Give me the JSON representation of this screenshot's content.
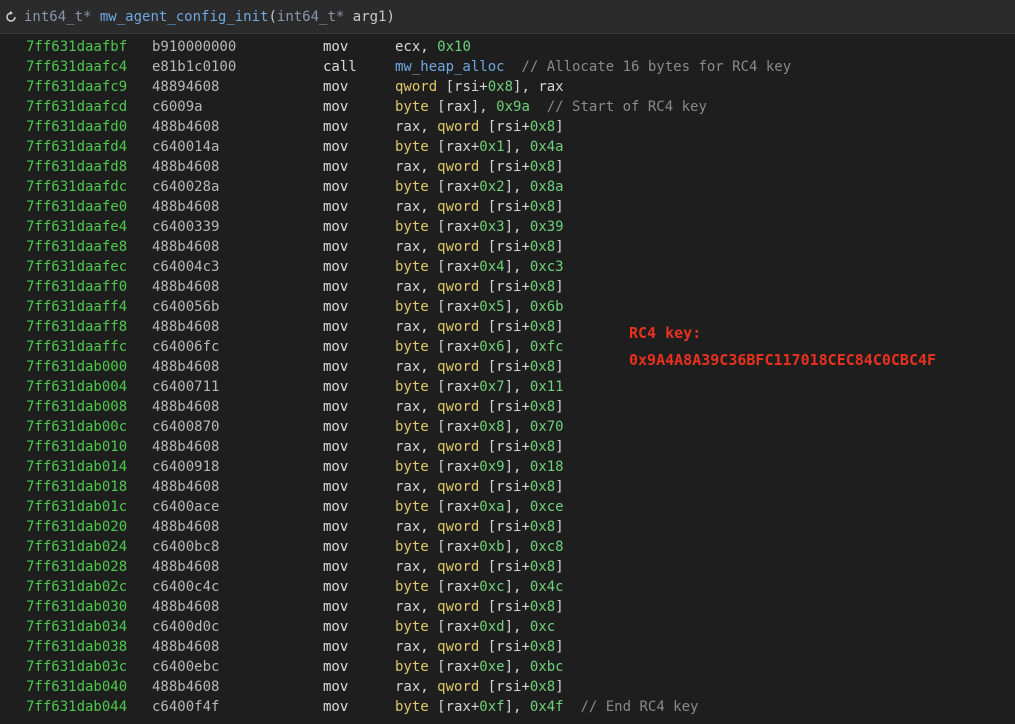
{
  "header": {
    "refresh_icon": "refresh-icon",
    "sig_ret": "int64_t*",
    "sig_name": "mw_agent_config_init",
    "sig_open": "(",
    "sig_argtype": "int64_t*",
    "sig_arg": "arg1)"
  },
  "annotation": {
    "label": "RC4 key:",
    "value": "0x9A4A8A39C36BFC117018CEC84C0CBC4F",
    "color": "#e8321e"
  },
  "colors": {
    "background": "#1e1e1e",
    "address": "#4ec94e",
    "number": "#6fd07a",
    "keyword": "#e0c86a",
    "function": "#6fa8e0",
    "comment": "#8a8a8a"
  },
  "rows": [
    {
      "addr": "7ff631daafbf",
      "bytes": "b910000000",
      "mnem": "mov",
      "ops": [
        [
          "reg",
          "ecx, "
        ],
        [
          "num",
          "0x10"
        ]
      ]
    },
    {
      "addr": "7ff631daafc4",
      "bytes": "e81b1c0100",
      "mnem": "call",
      "ops": [
        [
          "fn",
          "mw_heap_alloc"
        ],
        [
          "cmt",
          "  // Allocate 16 bytes for RC4 key"
        ]
      ]
    },
    {
      "addr": "7ff631daafc9",
      "bytes": "48894608",
      "mnem": "mov",
      "ops": [
        [
          "kw",
          "qword"
        ],
        [
          "p",
          " [rsi+"
        ],
        [
          "num",
          "0x8"
        ],
        [
          "p",
          "], rax"
        ]
      ]
    },
    {
      "addr": "7ff631daafcd",
      "bytes": "c6009a",
      "mnem": "mov",
      "ops": [
        [
          "kw",
          "byte"
        ],
        [
          "p",
          " [rax], "
        ],
        [
          "num",
          "0x9a"
        ],
        [
          "cmt",
          "  // Start of RC4 key"
        ]
      ]
    },
    {
      "addr": "7ff631daafd0",
      "bytes": "488b4608",
      "mnem": "mov",
      "ops": [
        [
          "p",
          "rax, "
        ],
        [
          "kw",
          "qword"
        ],
        [
          "p",
          " [rsi+"
        ],
        [
          "num",
          "0x8"
        ],
        [
          "p",
          "]"
        ]
      ]
    },
    {
      "addr": "7ff631daafd4",
      "bytes": "c640014a",
      "mnem": "mov",
      "ops": [
        [
          "kw",
          "byte"
        ],
        [
          "p",
          " [rax+"
        ],
        [
          "num",
          "0x1"
        ],
        [
          "p",
          "], "
        ],
        [
          "num",
          "0x4a"
        ]
      ]
    },
    {
      "addr": "7ff631daafd8",
      "bytes": "488b4608",
      "mnem": "mov",
      "ops": [
        [
          "p",
          "rax, "
        ],
        [
          "kw",
          "qword"
        ],
        [
          "p",
          " [rsi+"
        ],
        [
          "num",
          "0x8"
        ],
        [
          "p",
          "]"
        ]
      ]
    },
    {
      "addr": "7ff631daafdc",
      "bytes": "c640028a",
      "mnem": "mov",
      "ops": [
        [
          "kw",
          "byte"
        ],
        [
          "p",
          " [rax+"
        ],
        [
          "num",
          "0x2"
        ],
        [
          "p",
          "], "
        ],
        [
          "num",
          "0x8a"
        ]
      ]
    },
    {
      "addr": "7ff631daafe0",
      "bytes": "488b4608",
      "mnem": "mov",
      "ops": [
        [
          "p",
          "rax, "
        ],
        [
          "kw",
          "qword"
        ],
        [
          "p",
          " [rsi+"
        ],
        [
          "num",
          "0x8"
        ],
        [
          "p",
          "]"
        ]
      ]
    },
    {
      "addr": "7ff631daafe4",
      "bytes": "c6400339",
      "mnem": "mov",
      "ops": [
        [
          "kw",
          "byte"
        ],
        [
          "p",
          " [rax+"
        ],
        [
          "num",
          "0x3"
        ],
        [
          "p",
          "], "
        ],
        [
          "num",
          "0x39"
        ]
      ]
    },
    {
      "addr": "7ff631daafe8",
      "bytes": "488b4608",
      "mnem": "mov",
      "ops": [
        [
          "p",
          "rax, "
        ],
        [
          "kw",
          "qword"
        ],
        [
          "p",
          " [rsi+"
        ],
        [
          "num",
          "0x8"
        ],
        [
          "p",
          "]"
        ]
      ]
    },
    {
      "addr": "7ff631daafec",
      "bytes": "c64004c3",
      "mnem": "mov",
      "ops": [
        [
          "kw",
          "byte"
        ],
        [
          "p",
          " [rax+"
        ],
        [
          "num",
          "0x4"
        ],
        [
          "p",
          "], "
        ],
        [
          "num",
          "0xc3"
        ]
      ]
    },
    {
      "addr": "7ff631daaff0",
      "bytes": "488b4608",
      "mnem": "mov",
      "ops": [
        [
          "p",
          "rax, "
        ],
        [
          "kw",
          "qword"
        ],
        [
          "p",
          " [rsi+"
        ],
        [
          "num",
          "0x8"
        ],
        [
          "p",
          "]"
        ]
      ]
    },
    {
      "addr": "7ff631daaff4",
      "bytes": "c640056b",
      "mnem": "mov",
      "ops": [
        [
          "kw",
          "byte"
        ],
        [
          "p",
          " [rax+"
        ],
        [
          "num",
          "0x5"
        ],
        [
          "p",
          "], "
        ],
        [
          "num",
          "0x6b"
        ]
      ]
    },
    {
      "addr": "7ff631daaff8",
      "bytes": "488b4608",
      "mnem": "mov",
      "ops": [
        [
          "p",
          "rax, "
        ],
        [
          "kw",
          "qword"
        ],
        [
          "p",
          " [rsi+"
        ],
        [
          "num",
          "0x8"
        ],
        [
          "p",
          "]"
        ]
      ]
    },
    {
      "addr": "7ff631daaffc",
      "bytes": "c64006fc",
      "mnem": "mov",
      "ops": [
        [
          "kw",
          "byte"
        ],
        [
          "p",
          " [rax+"
        ],
        [
          "num",
          "0x6"
        ],
        [
          "p",
          "], "
        ],
        [
          "num",
          "0xfc"
        ]
      ]
    },
    {
      "addr": "7ff631dab000",
      "bytes": "488b4608",
      "mnem": "mov",
      "ops": [
        [
          "p",
          "rax, "
        ],
        [
          "kw",
          "qword"
        ],
        [
          "p",
          " [rsi+"
        ],
        [
          "num",
          "0x8"
        ],
        [
          "p",
          "]"
        ]
      ]
    },
    {
      "addr": "7ff631dab004",
      "bytes": "c6400711",
      "mnem": "mov",
      "ops": [
        [
          "kw",
          "byte"
        ],
        [
          "p",
          " [rax+"
        ],
        [
          "num",
          "0x7"
        ],
        [
          "p",
          "], "
        ],
        [
          "num",
          "0x11"
        ]
      ]
    },
    {
      "addr": "7ff631dab008",
      "bytes": "488b4608",
      "mnem": "mov",
      "ops": [
        [
          "p",
          "rax, "
        ],
        [
          "kw",
          "qword"
        ],
        [
          "p",
          " [rsi+"
        ],
        [
          "num",
          "0x8"
        ],
        [
          "p",
          "]"
        ]
      ]
    },
    {
      "addr": "7ff631dab00c",
      "bytes": "c6400870",
      "mnem": "mov",
      "ops": [
        [
          "kw",
          "byte"
        ],
        [
          "p",
          " [rax+"
        ],
        [
          "num",
          "0x8"
        ],
        [
          "p",
          "], "
        ],
        [
          "num",
          "0x70"
        ]
      ]
    },
    {
      "addr": "7ff631dab010",
      "bytes": "488b4608",
      "mnem": "mov",
      "ops": [
        [
          "p",
          "rax, "
        ],
        [
          "kw",
          "qword"
        ],
        [
          "p",
          " [rsi+"
        ],
        [
          "num",
          "0x8"
        ],
        [
          "p",
          "]"
        ]
      ]
    },
    {
      "addr": "7ff631dab014",
      "bytes": "c6400918",
      "mnem": "mov",
      "ops": [
        [
          "kw",
          "byte"
        ],
        [
          "p",
          " [rax+"
        ],
        [
          "num",
          "0x9"
        ],
        [
          "p",
          "], "
        ],
        [
          "num",
          "0x18"
        ]
      ]
    },
    {
      "addr": "7ff631dab018",
      "bytes": "488b4608",
      "mnem": "mov",
      "ops": [
        [
          "p",
          "rax, "
        ],
        [
          "kw",
          "qword"
        ],
        [
          "p",
          " [rsi+"
        ],
        [
          "num",
          "0x8"
        ],
        [
          "p",
          "]"
        ]
      ]
    },
    {
      "addr": "7ff631dab01c",
      "bytes": "c6400ace",
      "mnem": "mov",
      "ops": [
        [
          "kw",
          "byte"
        ],
        [
          "p",
          " [rax+"
        ],
        [
          "num",
          "0xa"
        ],
        [
          "p",
          "], "
        ],
        [
          "num",
          "0xce"
        ]
      ]
    },
    {
      "addr": "7ff631dab020",
      "bytes": "488b4608",
      "mnem": "mov",
      "ops": [
        [
          "p",
          "rax, "
        ],
        [
          "kw",
          "qword"
        ],
        [
          "p",
          " [rsi+"
        ],
        [
          "num",
          "0x8"
        ],
        [
          "p",
          "]"
        ]
      ]
    },
    {
      "addr": "7ff631dab024",
      "bytes": "c6400bc8",
      "mnem": "mov",
      "ops": [
        [
          "kw",
          "byte"
        ],
        [
          "p",
          " [rax+"
        ],
        [
          "num",
          "0xb"
        ],
        [
          "p",
          "], "
        ],
        [
          "num",
          "0xc8"
        ]
      ]
    },
    {
      "addr": "7ff631dab028",
      "bytes": "488b4608",
      "mnem": "mov",
      "ops": [
        [
          "p",
          "rax, "
        ],
        [
          "kw",
          "qword"
        ],
        [
          "p",
          " [rsi+"
        ],
        [
          "num",
          "0x8"
        ],
        [
          "p",
          "]"
        ]
      ]
    },
    {
      "addr": "7ff631dab02c",
      "bytes": "c6400c4c",
      "mnem": "mov",
      "ops": [
        [
          "kw",
          "byte"
        ],
        [
          "p",
          " [rax+"
        ],
        [
          "num",
          "0xc"
        ],
        [
          "p",
          "], "
        ],
        [
          "num",
          "0x4c"
        ]
      ]
    },
    {
      "addr": "7ff631dab030",
      "bytes": "488b4608",
      "mnem": "mov",
      "ops": [
        [
          "p",
          "rax, "
        ],
        [
          "kw",
          "qword"
        ],
        [
          "p",
          " [rsi+"
        ],
        [
          "num",
          "0x8"
        ],
        [
          "p",
          "]"
        ]
      ]
    },
    {
      "addr": "7ff631dab034",
      "bytes": "c6400d0c",
      "mnem": "mov",
      "ops": [
        [
          "kw",
          "byte"
        ],
        [
          "p",
          " [rax+"
        ],
        [
          "num",
          "0xd"
        ],
        [
          "p",
          "], "
        ],
        [
          "num",
          "0xc"
        ]
      ]
    },
    {
      "addr": "7ff631dab038",
      "bytes": "488b4608",
      "mnem": "mov",
      "ops": [
        [
          "p",
          "rax, "
        ],
        [
          "kw",
          "qword"
        ],
        [
          "p",
          " [rsi+"
        ],
        [
          "num",
          "0x8"
        ],
        [
          "p",
          "]"
        ]
      ]
    },
    {
      "addr": "7ff631dab03c",
      "bytes": "c6400ebc",
      "mnem": "mov",
      "ops": [
        [
          "kw",
          "byte"
        ],
        [
          "p",
          " [rax+"
        ],
        [
          "num",
          "0xe"
        ],
        [
          "p",
          "], "
        ],
        [
          "num",
          "0xbc"
        ]
      ]
    },
    {
      "addr": "7ff631dab040",
      "bytes": "488b4608",
      "mnem": "mov",
      "ops": [
        [
          "p",
          "rax, "
        ],
        [
          "kw",
          "qword"
        ],
        [
          "p",
          " [rsi+"
        ],
        [
          "num",
          "0x8"
        ],
        [
          "p",
          "]"
        ]
      ]
    },
    {
      "addr": "7ff631dab044",
      "bytes": "c6400f4f",
      "mnem": "mov",
      "ops": [
        [
          "kw",
          "byte"
        ],
        [
          "p",
          " [rax+"
        ],
        [
          "num",
          "0xf"
        ],
        [
          "p",
          "], "
        ],
        [
          "num",
          "0x4f"
        ],
        [
          "cmt",
          "  // End RC4 key"
        ]
      ]
    }
  ]
}
